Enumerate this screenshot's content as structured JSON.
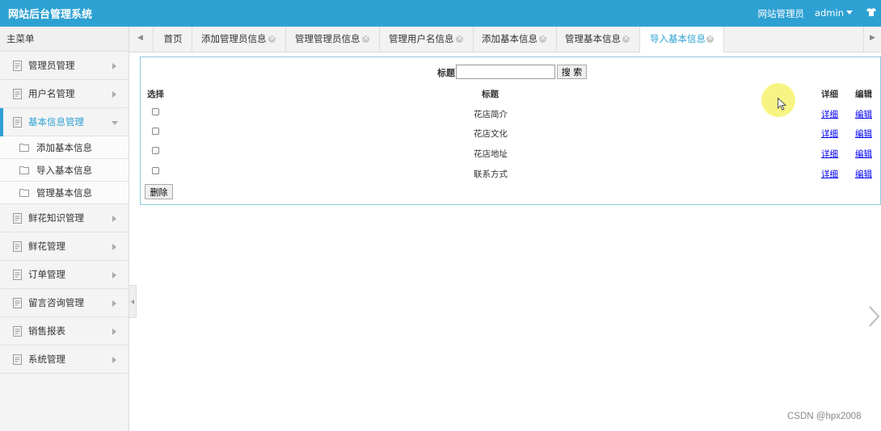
{
  "header": {
    "brand": "网站后台管理系统",
    "role": "网站管理员",
    "user": "admin"
  },
  "sidebar": {
    "title": "主菜单",
    "items": [
      {
        "label": "管理员管理"
      },
      {
        "label": "用户名管理"
      },
      {
        "label": "基本信息管理"
      },
      {
        "label": "鲜花知识管理"
      },
      {
        "label": "鲜花管理"
      },
      {
        "label": "订单管理"
      },
      {
        "label": "留言咨询管理"
      },
      {
        "label": "销售报表"
      },
      {
        "label": "系统管理"
      }
    ],
    "subitems": [
      {
        "label": "添加基本信息"
      },
      {
        "label": "导入基本信息"
      },
      {
        "label": "管理基本信息"
      }
    ]
  },
  "tabs": [
    {
      "label": "首页"
    },
    {
      "label": "添加管理员信息"
    },
    {
      "label": "管理管理员信息"
    },
    {
      "label": "管理用户名信息"
    },
    {
      "label": "添加基本信息"
    },
    {
      "label": "管理基本信息"
    },
    {
      "label": "导入基本信息"
    }
  ],
  "search": {
    "label": "标题:",
    "value": "",
    "button": "搜 索"
  },
  "table": {
    "headers": {
      "select": "选择",
      "title": "标题",
      "detail": "详细",
      "edit": "编辑"
    },
    "rows": [
      {
        "title": "花店简介",
        "detail": "详细",
        "edit": "编辑"
      },
      {
        "title": "花店文化",
        "detail": "详细",
        "edit": "编辑"
      },
      {
        "title": "花店地址",
        "detail": "详细",
        "edit": "编辑"
      },
      {
        "title": "联系方式",
        "detail": "详细",
        "edit": "编辑"
      }
    ],
    "delete_button": "删除"
  },
  "watermark": "CSDN @hpx2008",
  "colors": {
    "accent": "#2ea1d3",
    "link": "#0000ee"
  }
}
